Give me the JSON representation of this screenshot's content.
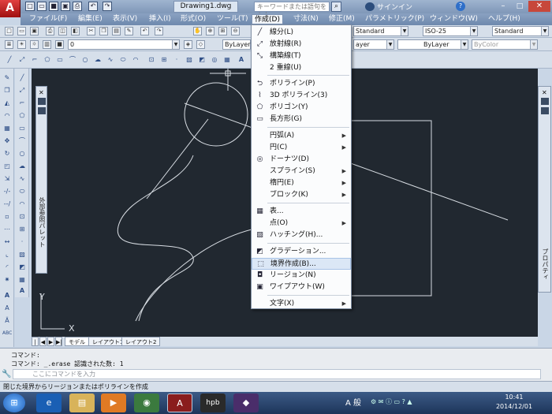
{
  "window": {
    "doc_tab": "Drawing1.dwg",
    "search_placeholder": "キーワードまたは語句を入力",
    "signin": "サインイン",
    "app_logo": "A"
  },
  "menubar": [
    "ファイル(F)",
    "編集(E)",
    "表示(V)",
    "挿入(I)",
    "形式(O)",
    "ツール(T)",
    "作成(D)",
    "寸法(N)",
    "修正(M)",
    "パラメトリック(P)",
    "ウィンドウ(W)",
    "ヘルプ(H)"
  ],
  "toolbar": {
    "layer_value": "0",
    "color_value": "ByLayer",
    "text_style": "Standard",
    "dim_style": "ISO-25",
    "table_style": "Standard",
    "linetype1": "ayer",
    "linetype2": "ByLayer",
    "plot_color": "ByColor"
  },
  "create_menu": [
    {
      "label": "線分(L)",
      "icon": "line-icon",
      "submenu": false
    },
    {
      "label": "放射線(R)",
      "icon": "ray-icon",
      "submenu": false
    },
    {
      "label": "構築線(T)",
      "icon": "xline-icon",
      "submenu": false
    },
    {
      "label": "2 重線(U)",
      "icon": "",
      "submenu": false
    },
    {
      "label": "ポリライン(P)",
      "icon": "polyline-icon",
      "submenu": false
    },
    {
      "label": "3D ポリライン(3)",
      "icon": "3dpolyline-icon",
      "submenu": false
    },
    {
      "label": "ポリゴン(Y)",
      "icon": "polygon-icon",
      "submenu": false
    },
    {
      "label": "長方形(G)",
      "icon": "rectangle-icon",
      "submenu": false
    },
    {
      "label": "円弧(A)",
      "icon": "",
      "submenu": true
    },
    {
      "label": "円(C)",
      "icon": "",
      "submenu": true
    },
    {
      "label": "ドーナツ(D)",
      "icon": "donut-icon",
      "submenu": false
    },
    {
      "label": "スプライン(S)",
      "icon": "",
      "submenu": true
    },
    {
      "label": "楕円(E)",
      "icon": "",
      "submenu": true
    },
    {
      "label": "ブロック(K)",
      "icon": "",
      "submenu": true
    },
    {
      "label": "表...",
      "icon": "table-icon",
      "submenu": false
    },
    {
      "label": "点(O)",
      "icon": "",
      "submenu": true
    },
    {
      "label": "ハッチング(H)...",
      "icon": "hatch-icon",
      "submenu": false
    },
    {
      "label": "グラデーション...",
      "icon": "gradient-icon",
      "submenu": false
    },
    {
      "label": "境界作成(B)...",
      "icon": "boundary-icon",
      "submenu": false
    },
    {
      "label": "リージョン(N)",
      "icon": "region-icon",
      "submenu": false
    },
    {
      "label": "ワイプアウト(W)",
      "icon": "wipeout-icon",
      "submenu": false
    },
    {
      "label": "文字(X)",
      "icon": "",
      "submenu": true
    }
  ],
  "palettes": {
    "left_label": "外部参照パレット",
    "right_label": "プロパティ"
  },
  "layout_tabs": [
    "モデル",
    "レイアウト1",
    "レイアウト2"
  ],
  "command": {
    "line1": "コマンド:",
    "line2": "コマンド:  _.erase 認識された数: 1",
    "prompt": "ここにコマンドを入力"
  },
  "status_text": "閉じた境界からリージョンまたはポリラインを作成",
  "canvas": {
    "ucs_y": "Y",
    "ucs_x": "X"
  },
  "taskbar": {
    "time": "10:41",
    "date": "2014/12/01",
    "ime_char": "A 般"
  },
  "colors": {
    "canvas_bg": "#212830",
    "titlebar": "#7f97b8",
    "menu_highlight": "#dbe7f6",
    "drawing_lines": "#d8dde3"
  }
}
